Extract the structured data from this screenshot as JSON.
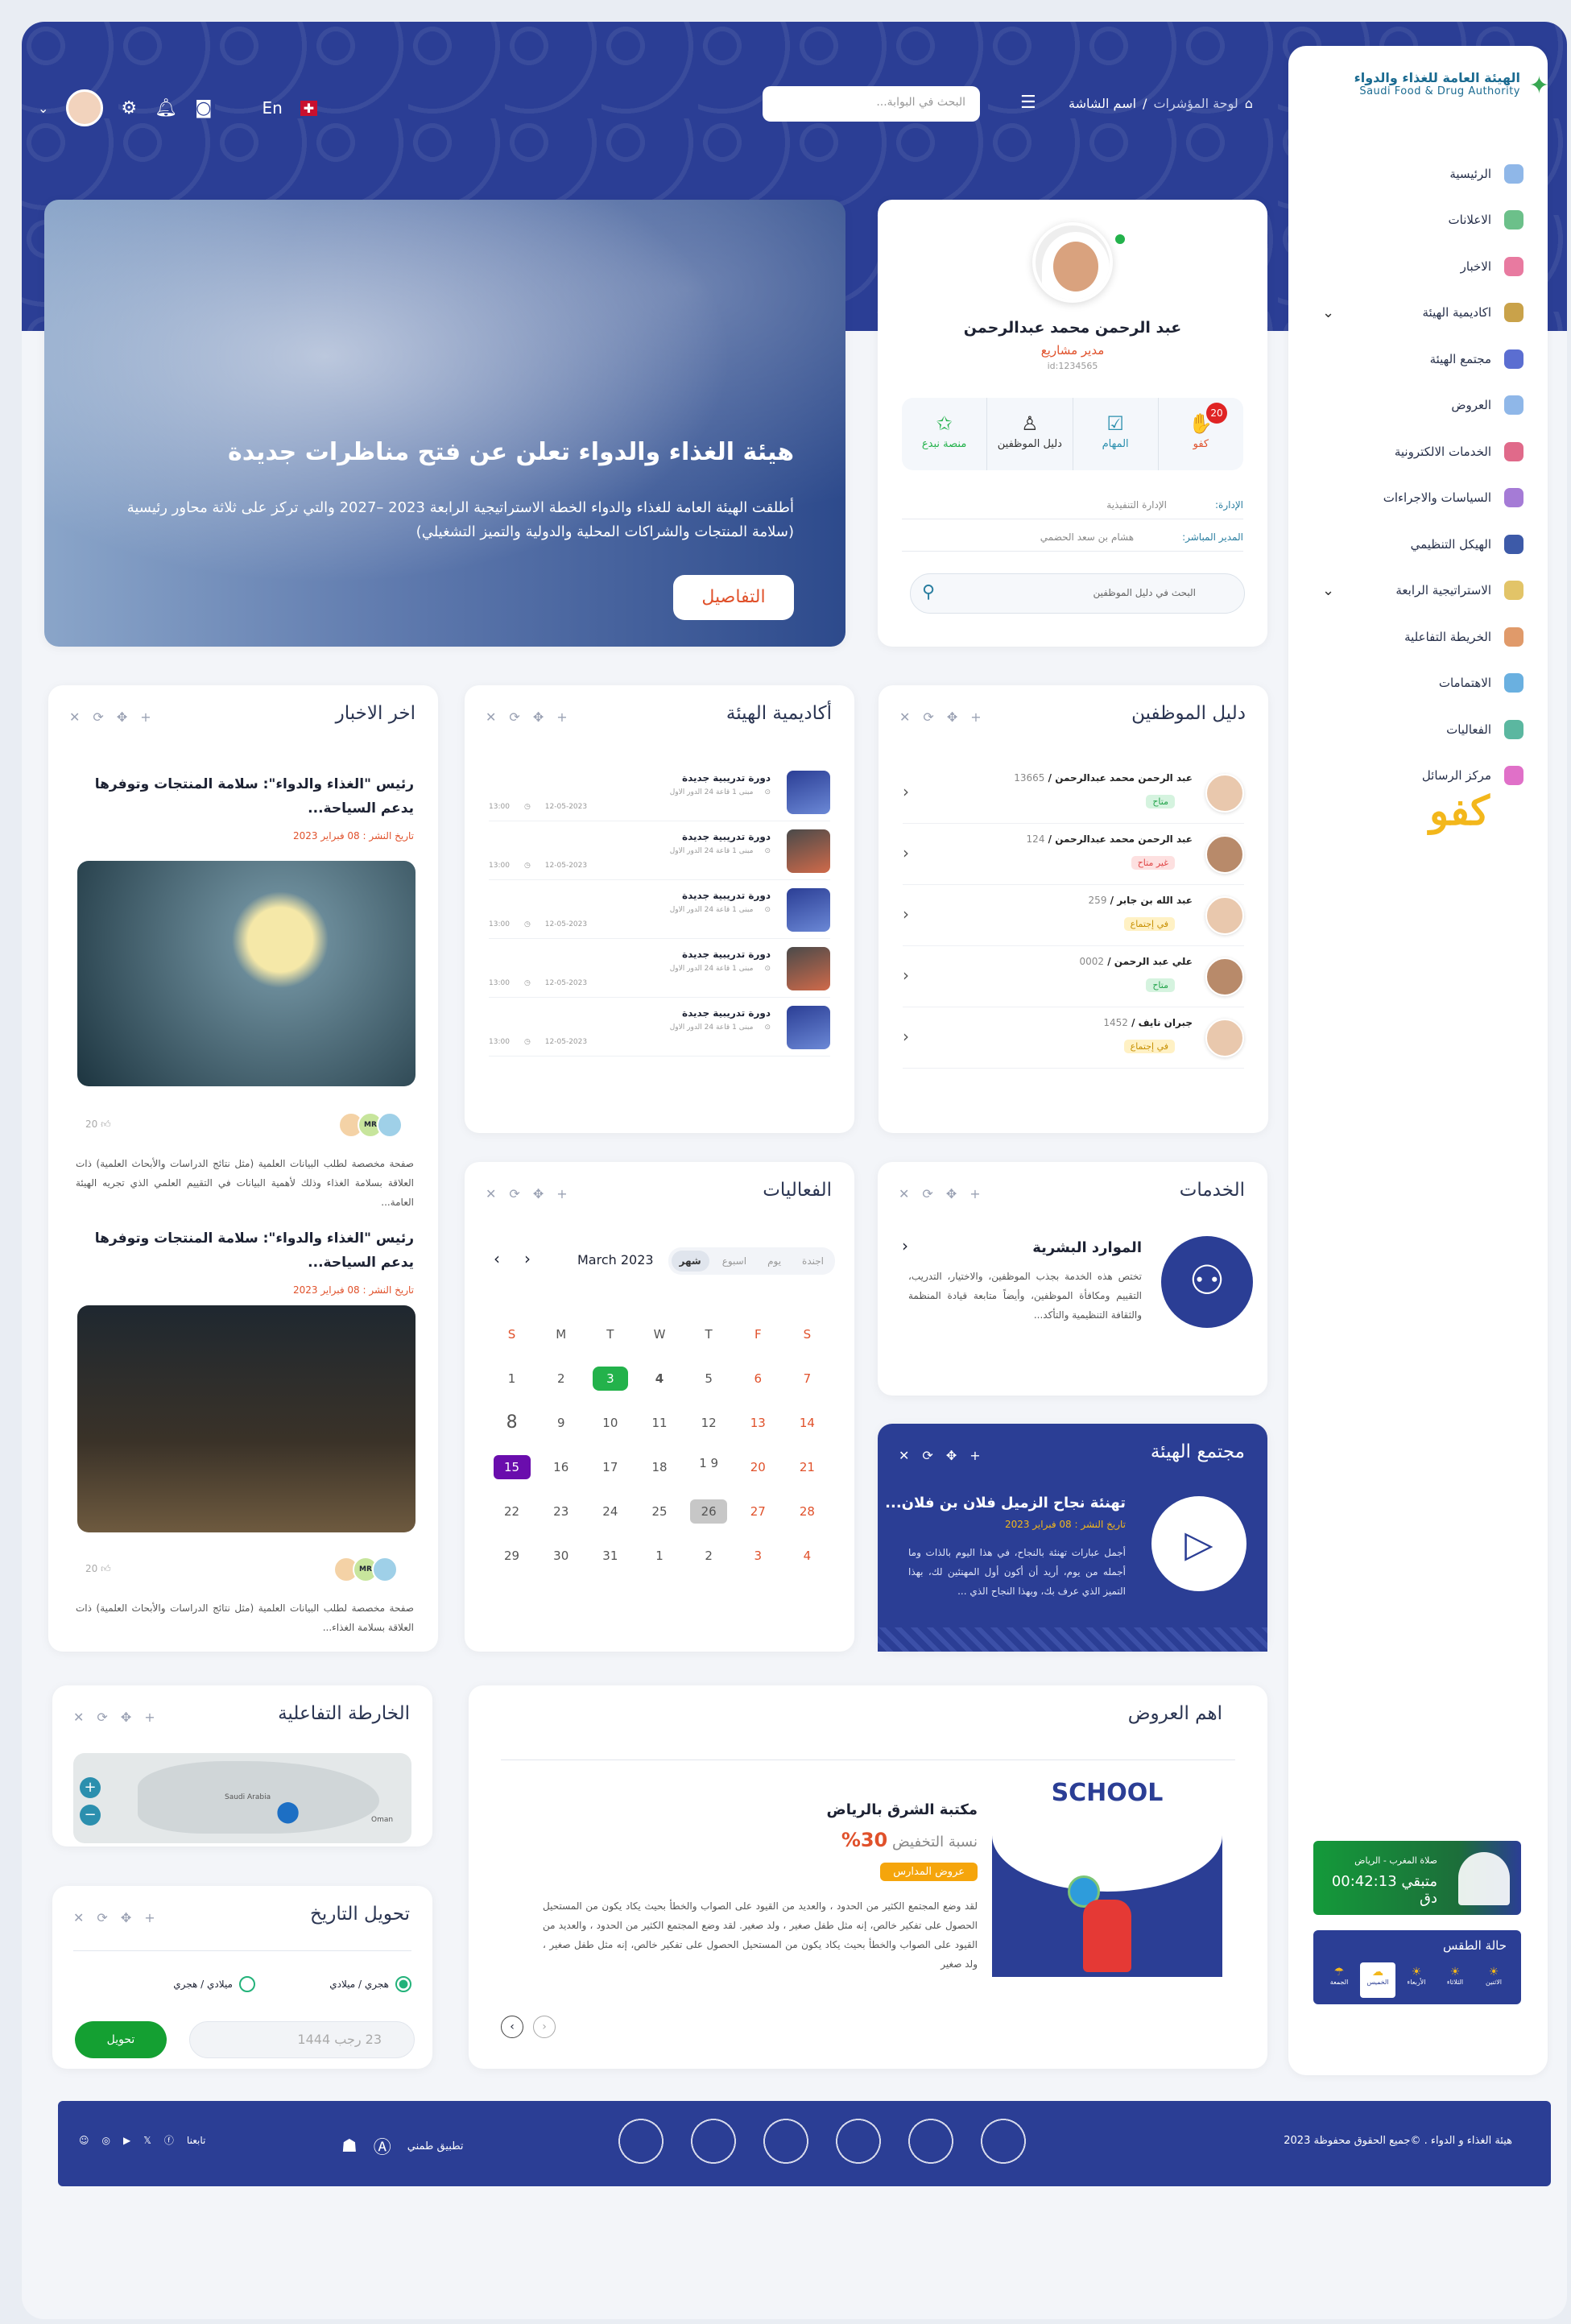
{
  "org": {
    "name_ar": "الهيئة العامة للغذاء والدواء",
    "name_en": "Saudi Food & Drug Authority"
  },
  "sidebar": {
    "items": [
      {
        "label": "الرئيسية",
        "icon": "home-icon",
        "color": "#8fb7e8"
      },
      {
        "label": "الاعلانات",
        "icon": "megaphone-icon",
        "color": "#6cc08a"
      },
      {
        "label": "الاخبار",
        "icon": "news-icon",
        "color": "#e87aa0"
      },
      {
        "label": "اكاديمية الهيئة",
        "icon": "book-icon",
        "color": "#c9a24a",
        "expand": true
      },
      {
        "label": "مجتمع الهيئة",
        "icon": "community-icon",
        "color": "#5b6ed1"
      },
      {
        "label": "العروض",
        "icon": "offer-icon",
        "color": "#8fb7e8"
      },
      {
        "label": "الخدمات الالكترونية",
        "icon": "services-icon",
        "color": "#e06a8a"
      },
      {
        "label": "السياسات والاجراءات",
        "icon": "policy-icon",
        "color": "#a57bd6"
      },
      {
        "label": "الهيكل التنظيمي",
        "icon": "org-chart-icon",
        "color": "#3d5aa8"
      },
      {
        "label": "الاستراتيجية الرابعة",
        "icon": "bulb-icon",
        "color": "#e2c468",
        "expand": true
      },
      {
        "label": "الخريطة التفاعلية",
        "icon": "map-icon",
        "color": "#e09a6a"
      },
      {
        "label": "الاهتمامات",
        "icon": "interests-icon",
        "color": "#6ab0e0"
      },
      {
        "label": "الفعاليات",
        "icon": "calendar-icon",
        "color": "#5bb7a0"
      },
      {
        "label": "مركز الرسائل",
        "icon": "messages-icon",
        "color": "#e070c8"
      }
    ],
    "kafu": "كفو"
  },
  "header": {
    "search_placeholder": "البحث في البوابة...",
    "crumb_home": "لوحة المؤشرات",
    "crumb_current": "اسم الشاشة",
    "lang": "En"
  },
  "profile": {
    "name": "عبد الرحمن محمد عبدالرحمن",
    "role": "مدير مشاريع",
    "id": "id:1234565",
    "actions": [
      {
        "label": "كفو",
        "icon": "hands-icon",
        "badge": "20"
      },
      {
        "label": "المهام",
        "icon": "tasks-icon"
      },
      {
        "label": "دليل الموظفين",
        "icon": "user-icon"
      },
      {
        "label": "منصة نبدع",
        "icon": "stars-icon"
      }
    ],
    "dept_label": "الإدارة:",
    "dept_value": "الإدارة التنفيذية",
    "mgr_label": "المدير المباشر:",
    "mgr_value": "هشام بن سعد الحضمي",
    "search": "البحث في دليل الموظفين"
  },
  "banner": {
    "title": "هيئة الغذاء والدواء تعلن عن فتح مناظرات جديدة",
    "text": "أطلقت الهيئة العامة للغذاء والدواء الخطة الاستراتيجية الرابعة 2023 –2027 والتي تركز على ثلاثة محاور رئيسية (سلامة المنتجات والشراكات المحلية والدولية والتميز التشغيلي)",
    "button": "التفاصيل"
  },
  "employees": {
    "title": "دليل الموظفين",
    "rows": [
      {
        "name": "عبد الرحمن محمد عبدالرحمن",
        "num": "13665",
        "status": "متاح",
        "kind": "av1"
      },
      {
        "name": "عبد الرحمن محمد عبدالرحمن",
        "num": "124",
        "status": "غير متاح",
        "kind": "un"
      },
      {
        "name": "عبد الله بن جابر",
        "num": "259",
        "status": "في إجتماع",
        "kind": "mt"
      },
      {
        "name": "علي عبد الرحمن",
        "num": "0002",
        "status": "متاح",
        "kind": "av1"
      },
      {
        "name": "جبران نايف",
        "num": "1452",
        "status": "في إجتماع",
        "kind": "mt"
      }
    ]
  },
  "academy": {
    "title": "أكاديمية الهيئة",
    "rows": [
      {
        "title": "دورة تدريبية جديدة",
        "place": "مبنى 1 قاعة 24 الدور الاول",
        "date": "12-05-2023",
        "time": "13:00"
      },
      {
        "title": "دورة تدريبية جديدة",
        "place": "مبنى 1 قاعة 24 الدور الاول",
        "date": "12-05-2023",
        "time": "13:00"
      },
      {
        "title": "دورة تدريبية جديدة",
        "place": "مبنى 1 قاعة 24 الدور الاول",
        "date": "12-05-2023",
        "time": "13:00"
      },
      {
        "title": "دورة تدريبية جديدة",
        "place": "مبنى 1 قاعة 24 الدور الاول",
        "date": "12-05-2023",
        "time": "13:00"
      },
      {
        "title": "دورة تدريبية جديدة",
        "place": "مبنى 1 قاعة 24 الدور الاول",
        "date": "12-05-2023",
        "time": "13:00"
      }
    ]
  },
  "news": {
    "title": "اخر الاخبار",
    "items": [
      {
        "title": "رئيس \"الغذاء والدواء\": سلامة المنتجات وتوفرها يدعم السياحة...",
        "date": "تاريخ النشر : 08 فبراير 2023",
        "likes": "20",
        "desc": "صفحة مخصصة لطلب البيانات العلمية (مثل نتائج الدراسات والأبحاث العلمية) ذات العلاقة بسلامة الغذاء وذلك لأهمية البيانات في التقييم العلمي الذي تجريه الهيئة العامة..."
      },
      {
        "title": "رئيس \"الغذاء والدواء\": سلامة المنتجات وتوفرها يدعم السياحة...",
        "date": "تاريخ النشر : 08 فبراير 2023",
        "likes": "20",
        "desc": "صفحة مخصصة لطلب البيانات العلمية (مثل نتائج الدراسات والأبحاث العلمية) ذات العلاقة بسلامة الغذاء..."
      }
    ],
    "avatar_initials": "MR"
  },
  "services": {
    "title": "الخدمات",
    "item_title": "الموارد البشرية",
    "item_desc": "تختص هذه الخدمة بجذب الموظفين، والاختيار، التدريب، التقييم ومكافأة الموظفين، وأيضاً متابعة قيادة المنظمة والثقافة التنظيمية والتأكد..."
  },
  "events": {
    "title": "الفعاليات",
    "tabs": [
      "اجندة",
      "يوم",
      "اسبوع",
      "شهر"
    ],
    "month": "March 2023",
    "days": [
      "S",
      "M",
      "T",
      "W",
      "T",
      "F",
      "S"
    ],
    "weeks": [
      [
        "1",
        "2",
        "3",
        "4",
        "5",
        "6",
        "7"
      ],
      [
        "8",
        "9",
        "10",
        "11",
        "12",
        "13",
        "14"
      ],
      [
        "15",
        "16",
        "17",
        "18",
        "1 9",
        "20",
        "21"
      ],
      [
        "22",
        "23",
        "24",
        "25",
        "26",
        "27",
        "28"
      ],
      [
        "29",
        "30",
        "31",
        "1",
        "2",
        "3",
        "4"
      ]
    ]
  },
  "community": {
    "title": "مجتمع الهيئة",
    "item_title": "تهنئة نجاح الزميل فلان بن فلان...",
    "date": "تاريخ النشر : 08 فبراير 2023",
    "desc": "أجمل عبارات تهنئة بالنجاح، في هذا اليوم بالذات وما أجمله من يوم، أريد أن أكون أول المهنئين لك، بهذا التميز الذي عرف بك، وبهذا النجاح الذي ..."
  },
  "offers": {
    "title": "اهم العروض",
    "item_title": "مكتبة الشرق بالرياض",
    "discount_label": "نسبة التخفيض",
    "discount": "30%",
    "tag": "عروض المدارس",
    "img_text": "SCHOOL",
    "desc": "لقد وضع المجتمع الكثير من الحدود ، والعديد من القيود على الصواب والخطأ بحيث يكاد يكون من المستحيل الحصول على تفكير خالص، إنه مثل طفل صغير ، ولد صغير. لقد وضع المجتمع الكثير من الحدود ، والعديد من القيود على الصواب والخطأ بحيث يكاد يكون من المستحيل الحصول على تفكير خالص، إنه مثل طفل صغير ، ولد صغير"
  },
  "map": {
    "title": "الخارطة التفاعلية",
    "labels": [
      "Saudi Arabia",
      "Oman"
    ]
  },
  "converter": {
    "title": "تحويل التاريخ",
    "opt1": "هجري / ميلادي",
    "opt2": "ميلادي / هجري",
    "placeholder": "23 رجب 1444",
    "button": "تحويل"
  },
  "prayer": {
    "label": "صلاة المغرب - الرياض",
    "remaining": "متبقي 00:42:13 دق"
  },
  "weather": {
    "title": "حالة الطقس",
    "days": [
      "الاثنين",
      "الثلاثاء",
      "الأربعاء",
      "الخميس",
      "الجمعة"
    ],
    "temps": [
      "",
      "",
      "",
      "",
      ""
    ]
  },
  "footer": {
    "copyright": "هيئة الغذاء و الدواء .    ©جميع الحقوق محفوظة 2023",
    "app": "تطبيق طمني",
    "follow": "تابعنا"
  }
}
